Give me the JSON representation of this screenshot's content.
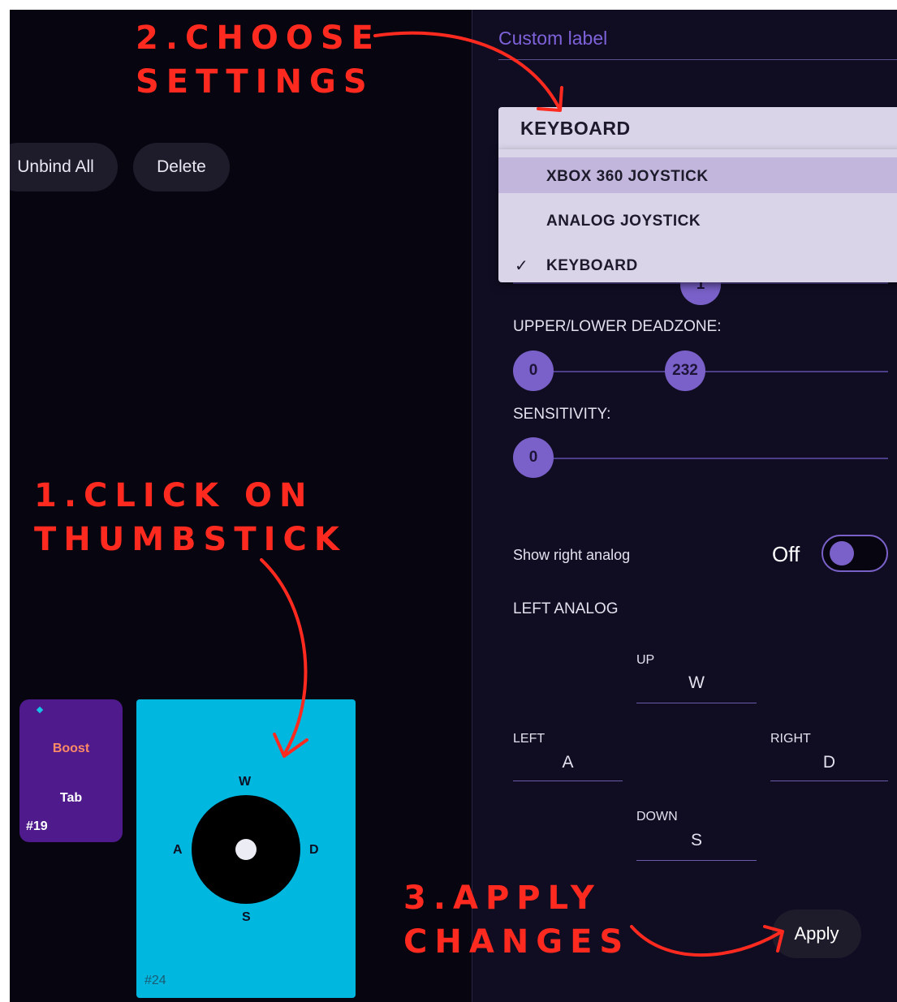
{
  "toolbar": {
    "unbind_all_label": "Unbind All",
    "delete_label": "Delete"
  },
  "tiles": {
    "boost": {
      "action": "Boost",
      "key": "Tab",
      "number": "#19"
    },
    "stick": {
      "up": "W",
      "left": "A",
      "right": "D",
      "down": "S",
      "number": "#24"
    }
  },
  "panel": {
    "custom_label_placeholder": "Custom label",
    "input_type": {
      "selected": "KEYBOARD",
      "options": [
        {
          "label": "XBOX 360 JOYSTICK",
          "highlighted": true,
          "checked": false
        },
        {
          "label": "ANALOG JOYSTICK",
          "highlighted": false,
          "checked": false
        },
        {
          "label": "KEYBOARD",
          "highlighted": false,
          "checked": true
        }
      ],
      "check_glyph": "✓"
    },
    "hidden_slider_value": "1",
    "deadzone": {
      "label": "UPPER/LOWER DEADZONE:",
      "lower": "0",
      "upper": "232"
    },
    "sensitivity": {
      "label": "SENSITIVITY:",
      "value": "0"
    },
    "show_right_analog": {
      "label": "Show right analog",
      "state": "Off"
    },
    "left_analog": {
      "title": "LEFT ANALOG",
      "up": {
        "label": "UP",
        "value": "W"
      },
      "left": {
        "label": "LEFT",
        "value": "A"
      },
      "right": {
        "label": "RIGHT",
        "value": "D"
      },
      "down": {
        "label": "DOWN",
        "value": "S"
      }
    },
    "apply_label": "Apply"
  },
  "annotations": {
    "step1": "1.CLICK ON\nTHUMBSTICK",
    "step2": "2.CHOOSE\nSETTINGS",
    "step3": "3.APPLY\nCHANGES",
    "color": "#ff2a1f"
  },
  "colors": {
    "accent": "#7a61c9",
    "panel_bg": "#100d23",
    "stick_tile": "#00b7e0",
    "boost_tile": "#4f1a8c"
  }
}
